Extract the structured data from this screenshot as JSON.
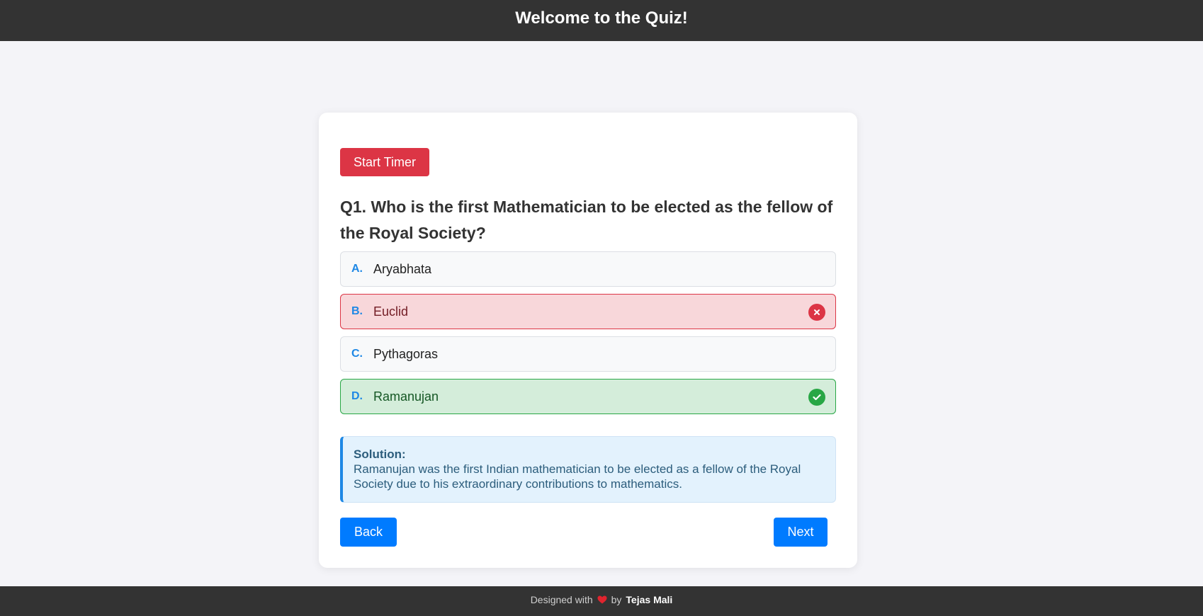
{
  "header": {
    "title": "Welcome to the Quiz!"
  },
  "quiz": {
    "timer_button": "Start Timer",
    "question": "Q1. Who is the first Mathematician to be elected as the fellow of the Royal Society?",
    "options": [
      {
        "letter": "A.",
        "text": "Aryabhata",
        "state": "neutral"
      },
      {
        "letter": "B.",
        "text": "Euclid",
        "state": "wrong"
      },
      {
        "letter": "C.",
        "text": "Pythagoras",
        "state": "neutral"
      },
      {
        "letter": "D.",
        "text": "Ramanujan",
        "state": "correct"
      }
    ],
    "solution": {
      "label": "Solution:",
      "text": "Ramanujan was the first Indian mathematician to be elected as a fellow of the Royal Society due to his extraordinary contributions to mathematics."
    },
    "back_button": "Back",
    "next_button": "Next"
  },
  "footer": {
    "prefix": "Designed with",
    "by": "by",
    "author": "Tejas Mali",
    "heart_icon": "heart-icon"
  },
  "colors": {
    "header_bg": "#333333",
    "timer_red": "#dc3545",
    "primary_blue": "#007bff",
    "wrong_bg": "#f8d7da",
    "correct_bg": "#d4edda",
    "solution_bg": "#e3f2fd"
  }
}
